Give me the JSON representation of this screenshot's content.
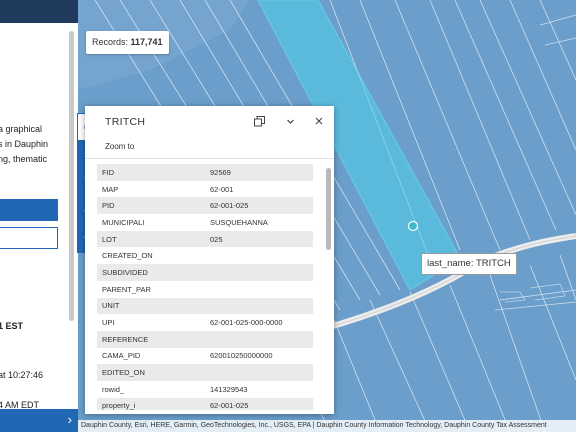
{
  "records": {
    "label": "Records:",
    "count": "117,741"
  },
  "hover_label": "last_name: TRITCH",
  "attribution": "Dauphin County, Esri, HERE, Garmin, GeoTechnologies, Inc., USGS, EPA | Dauphin County Information Technology, Dauphin County Tax Assessment",
  "panel": {
    "lines": [
      "a graphical",
      "s in Dauphin",
      "ng, thematic",
      "1 EST",
      "at 10:27:46",
      "4 AM EDT"
    ]
  },
  "tools": [
    {
      "name": "info-icon"
    },
    {
      "name": "comment-icon"
    },
    {
      "name": "filter-icon"
    },
    {
      "name": "download-icon"
    },
    {
      "name": "star-icon"
    }
  ],
  "popup": {
    "title": "TRITCH",
    "zoom_to": "Zoom to",
    "rows": [
      {
        "key": "FID",
        "value": "92569"
      },
      {
        "key": "MAP",
        "value": "62-001"
      },
      {
        "key": "PID",
        "value": "62-001-025"
      },
      {
        "key": "MUNICIPALI",
        "value": "SUSQUEHANNA"
      },
      {
        "key": "LOT",
        "value": "025"
      },
      {
        "key": "CREATED_ON",
        "value": ""
      },
      {
        "key": "SUBDIVIDED",
        "value": ""
      },
      {
        "key": "PARENT_PAR",
        "value": ""
      },
      {
        "key": "UNIT",
        "value": ""
      },
      {
        "key": "UPI",
        "value": "62-001-025-000-0000"
      },
      {
        "key": "REFERENCE",
        "value": ""
      },
      {
        "key": "CAMA_PID",
        "value": "620010250000000"
      },
      {
        "key": "EDITED_ON",
        "value": ""
      },
      {
        "key": "rowid_",
        "value": "141329543"
      },
      {
        "key": "property_i",
        "value": "62-001-025"
      }
    ]
  },
  "colors": {
    "map_water": "#6b9ecb",
    "parcel_highlight": "#4fd2ea",
    "accent": "#2067b4",
    "panel_header": "#1f3a5d"
  }
}
